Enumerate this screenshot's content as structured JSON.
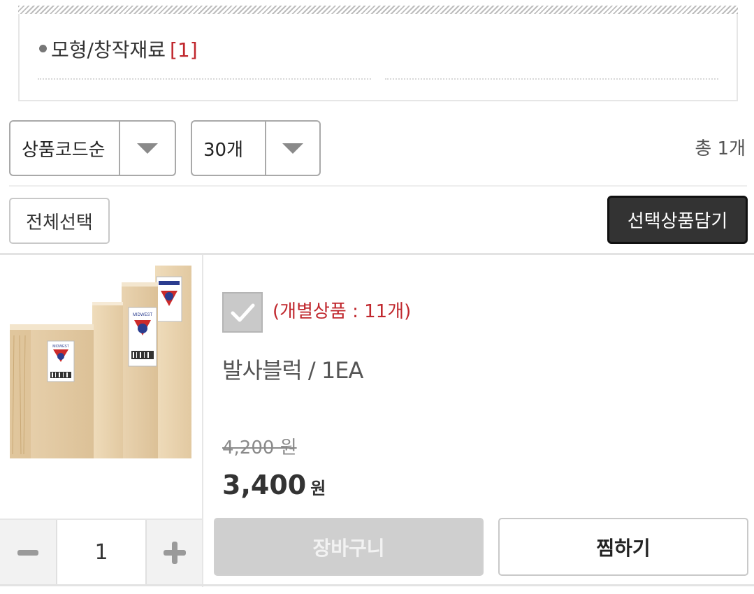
{
  "category": {
    "name": "모형/창작재료",
    "count": "[1]"
  },
  "sort_select": {
    "value": "상품코드순"
  },
  "count_select": {
    "value": "30개"
  },
  "total_label": "총 1개",
  "select_all_label": "전체선택",
  "add_selected_label": "선택상품담기",
  "product": {
    "individual_label": "(개별상품 : 11개)",
    "name": "발사블럭 / 1EA",
    "original_price": "4,200 원",
    "price": "3,400",
    "currency": "원",
    "quantity": "1",
    "cart_label": "장바구니",
    "wish_label": "찜하기",
    "label_brand": "MIDWEST"
  },
  "colors": {
    "accent_red": "#c0272d",
    "dark_button": "#333333"
  }
}
